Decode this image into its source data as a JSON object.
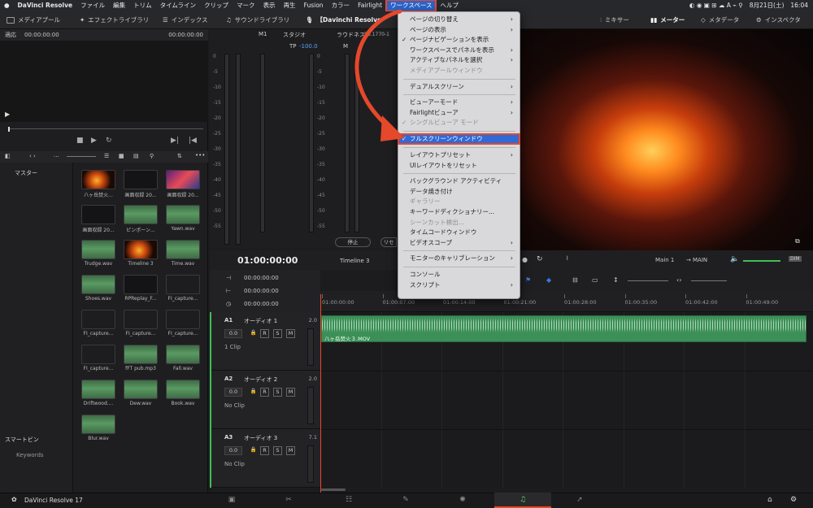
{
  "mac_menubar": {
    "apple": "",
    "items": [
      "DaVinci Resolve",
      "ファイル",
      "編集",
      "トリム",
      "タイムライン",
      "クリップ",
      "マーク",
      "表示",
      "再生",
      "Fusion",
      "カラー",
      "Fairlight",
      "ワークスペース",
      "ヘルプ"
    ],
    "date": "8月21日(土)",
    "time": "16:04"
  },
  "toolbar": {
    "media_pool": "メディアプール",
    "effects": "エフェクトライブラリ",
    "index": "インデックス",
    "sound_library": "サウンドライブラリ",
    "project_title": "【Davinchi Resolve",
    "mixer": "ミキサー",
    "meters": "メーター",
    "metadata": "メタデータ",
    "inspector": "インスペクタ"
  },
  "left_viewer": {
    "fit": "適応",
    "tc_left": "00:00:00:00",
    "tc_right": "00:00:00:00"
  },
  "bins": {
    "master": "マスター",
    "smart_bins": "スマートビン",
    "keywords": "Keywords"
  },
  "clips": [
    {
      "name": "八ヶ岳焚火...",
      "kind": "fire"
    },
    {
      "name": "画面収録 20...",
      "kind": "dark"
    },
    {
      "name": "画面収録 20...",
      "kind": "screen"
    },
    {
      "name": "画面収録 20...",
      "kind": "dark"
    },
    {
      "name": "ピンポーン...",
      "kind": "wave"
    },
    {
      "name": "Yawn.wav",
      "kind": "wave"
    },
    {
      "name": "Trudge.wav",
      "kind": "wave"
    },
    {
      "name": "Timeline 3",
      "kind": "fire"
    },
    {
      "name": "Time.wav",
      "kind": "wave"
    },
    {
      "name": "Shoes.wav",
      "kind": "wave"
    },
    {
      "name": "RPReplay_F...",
      "kind": "dark"
    },
    {
      "name": "FI_capture...",
      "kind": "empty"
    },
    {
      "name": "FI_capture...",
      "kind": "empty"
    },
    {
      "name": "FI_capture...",
      "kind": "empty"
    },
    {
      "name": "FI_capture...",
      "kind": "empty"
    },
    {
      "name": "FI_capture...",
      "kind": "empty"
    },
    {
      "name": "fFT pub.mp3",
      "kind": "wave"
    },
    {
      "name": "Fall.wav",
      "kind": "wave"
    },
    {
      "name": "Driftwood....",
      "kind": "wave"
    },
    {
      "name": "Dew.wav",
      "kind": "wave"
    },
    {
      "name": "Book.wav",
      "kind": "wave"
    },
    {
      "name": "Blur.wav",
      "kind": "wave"
    }
  ],
  "meters": {
    "m1": "M1",
    "studio": "スタジオ",
    "loudness": "ラウドネス",
    "loudness_std": "BS.1770-1",
    "tp": "TP",
    "tp_value": "-100.0",
    "m": "M",
    "stop": "停止",
    "reset": "リセ",
    "scale": [
      "0",
      "-5",
      "-10",
      "-15",
      "-20",
      "-25",
      "-30",
      "-35",
      "-40",
      "-45",
      "-50",
      "-55"
    ]
  },
  "workspace_menu": {
    "items": [
      {
        "label": "ページの切り替え",
        "sub": true
      },
      {
        "label": "ページの表示",
        "sub": true
      },
      {
        "label": "ページナビゲーションを表示",
        "check": true
      },
      {
        "label": "ワークスペースでパネルを表示",
        "sub": true
      },
      {
        "label": "アクティブなパネルを選択",
        "sub": true
      },
      {
        "label": "メディアプールウィンドウ",
        "disabled": true
      },
      {
        "sep": true
      },
      {
        "label": "デュアルスクリーン",
        "sub": true
      },
      {
        "sep": true
      },
      {
        "label": "ビューアーモード",
        "sub": true
      },
      {
        "label": "Fairlightビューア",
        "sub": true
      },
      {
        "label": "シングルビューア モード",
        "check": true,
        "disabled": true
      },
      {
        "sep": true
      },
      {
        "label": "フルスクリーンウィンドウ",
        "check": true,
        "selected": true
      },
      {
        "sep": true
      },
      {
        "label": "レイアウトプリセット",
        "sub": true
      },
      {
        "label": "UIレイアウトをリセット"
      },
      {
        "sep": true
      },
      {
        "label": "バックグラウンド アクティビティ"
      },
      {
        "label": "データ焼き付け"
      },
      {
        "label": "ギャラリー",
        "disabled": true
      },
      {
        "label": "キーワードディクショナリー..."
      },
      {
        "label": "シーンカット検出...",
        "disabled": true
      },
      {
        "label": "タイムコードウィンドウ"
      },
      {
        "label": "ビデオスコープ",
        "sub": true
      },
      {
        "sep": true
      },
      {
        "label": "モニターのキャリブレーション",
        "sub": true
      },
      {
        "sep": true
      },
      {
        "label": "コンソール"
      },
      {
        "label": "スクリプト",
        "sub": true
      }
    ]
  },
  "viewer": {
    "main1": "Main 1",
    "main": "MAIN",
    "dim": "DIM"
  },
  "timeline": {
    "timecode": "01:00:00:00",
    "name": "Timeline 3",
    "head_tc": [
      "00:00:00:00",
      "00:00:00:00",
      "00:00:00:00"
    ],
    "ruler": [
      "01:00:00:00",
      "01:00:07:00",
      "01:00:14:00",
      "01:00:21:00",
      "01:00:28:00",
      "01:00:35:00",
      "01:00:42:00",
      "01:00:49:00"
    ],
    "tracks": [
      {
        "id": "A1",
        "name": "オーディオ 1",
        "ch": "2.0",
        "vol": "0.0",
        "clips": "1 Clip"
      },
      {
        "id": "A2",
        "name": "オーディオ 2",
        "ch": "2.0",
        "vol": "0.0",
        "clips": "No Clip"
      },
      {
        "id": "A3",
        "name": "オーディオ 3",
        "ch": "7.1",
        "vol": "0.0",
        "clips": "No Clip"
      }
    ],
    "clip_name": "八ヶ岳焚火３.MOV",
    "r": "R",
    "s": "S",
    "mbtn": "M"
  },
  "footer": {
    "app": "DaVinci Resolve 17",
    "pages": [
      "media-icon",
      "cut-icon",
      "edit-icon",
      "fusion-icon",
      "color-icon",
      "fairlight-icon",
      "deliver-icon"
    ]
  },
  "colors": {
    "accent": "#2f6bd8",
    "highlight": "#e5482b",
    "clip": "#3b8f57"
  }
}
